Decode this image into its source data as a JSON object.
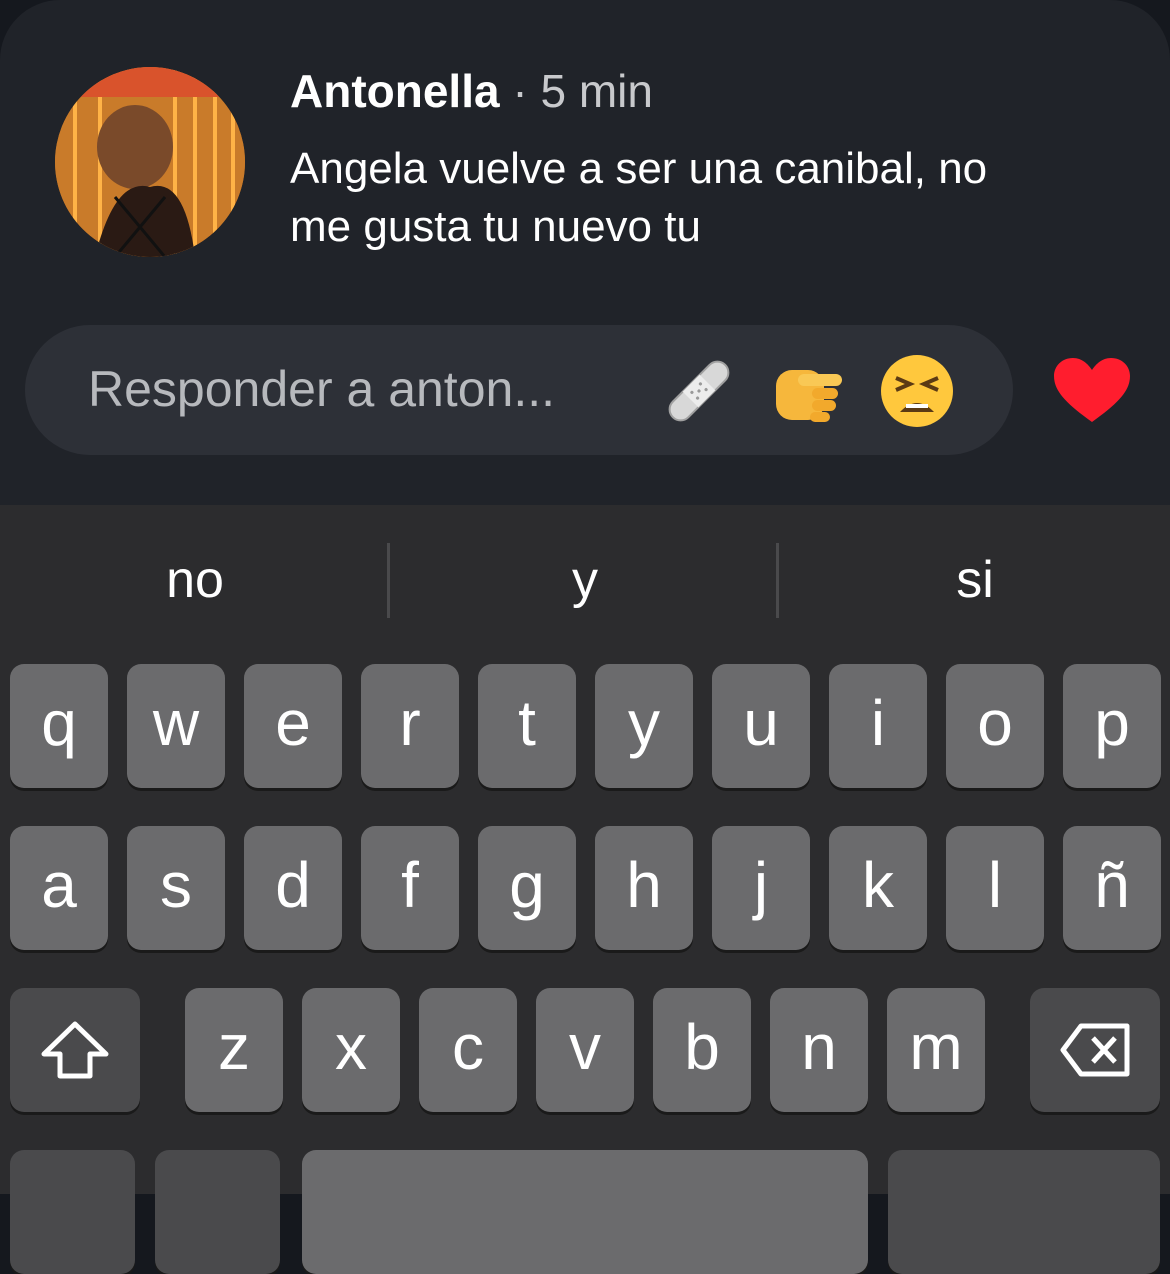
{
  "comment": {
    "author": "Antonella",
    "separator": "·",
    "time": "5 min",
    "text_line1": "Angela vuelve a ser una canibal, no",
    "text_line2": "me gusta tu nuevo tu"
  },
  "reply": {
    "placeholder": "Responder a anton...",
    "emojis": [
      "bandage-icon",
      "pointing-fist-icon",
      "tired-face-icon"
    ],
    "like": "heart-icon"
  },
  "suggestions": [
    "no",
    "y",
    "si"
  ],
  "keyboard": {
    "row1": [
      "q",
      "w",
      "e",
      "r",
      "t",
      "y",
      "u",
      "i",
      "o",
      "p"
    ],
    "row2": [
      "a",
      "s",
      "d",
      "f",
      "g",
      "h",
      "j",
      "k",
      "l",
      "ñ"
    ],
    "row3": [
      "z",
      "x",
      "c",
      "v",
      "b",
      "n",
      "m"
    ],
    "shift": "shift-icon",
    "delete": "backspace-icon"
  },
  "colors": {
    "heart": "#ff1d2e",
    "card": "#202329",
    "keyboard": "#2c2c2e"
  }
}
